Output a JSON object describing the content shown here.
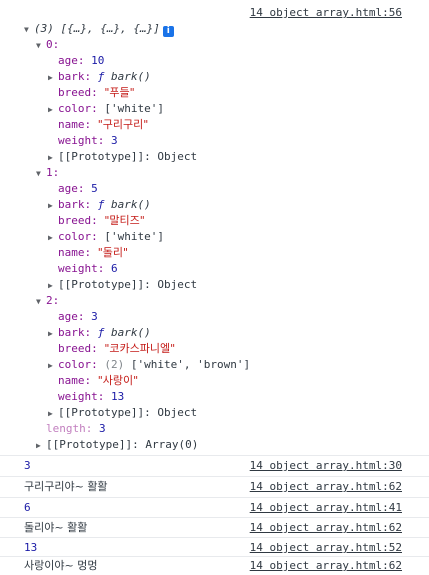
{
  "top_source": "14 object array.html:56",
  "array_summary": {
    "count": "(3)",
    "preview": "[{…}, {…}, {…}]",
    "badge": "i"
  },
  "items": [
    {
      "index": "0:",
      "age": "10",
      "bark_kw": "ƒ",
      "bark_name": "bark()",
      "breed": "\"푸들\"",
      "color": "['white']",
      "name": "\"구리구리\"",
      "weight": "3",
      "prototype": "Object"
    },
    {
      "index": "1:",
      "age": "5",
      "bark_kw": "ƒ",
      "bark_name": "bark()",
      "breed": "\"말티즈\"",
      "color": "['white']",
      "name": "\"돌리\"",
      "weight": "6",
      "prototype": "Object"
    },
    {
      "index": "2:",
      "age": "3",
      "bark_kw": "ƒ",
      "bark_name": "bark()",
      "breed": "\"코카스파니엘\"",
      "color_count": "(2)",
      "color": "['white', 'brown']",
      "name": "\"사랑이\"",
      "weight": "13",
      "prototype": "Object"
    }
  ],
  "labels": {
    "age": "age: ",
    "bark": "bark: ",
    "breed": "breed: ",
    "color": "color: ",
    "name": "name: ",
    "weight": "weight: ",
    "prototype": "[[Prototype]]: ",
    "length": "length: "
  },
  "length_value": "3",
  "array_prototype": "Array(0)",
  "logs": [
    {
      "text": "3",
      "kind": "number",
      "source": "14 object array.html:30"
    },
    {
      "text": "구리구리야~ 활활",
      "kind": "text",
      "source": "14 object array.html:62"
    },
    {
      "text": "6",
      "kind": "number",
      "source": "14 object array.html:41"
    },
    {
      "text": "돌리야~ 활활",
      "kind": "text",
      "source": "14 object array.html:62"
    },
    {
      "text": "13",
      "kind": "number",
      "source": "14 object array.html:52"
    },
    {
      "text": "사랑이야~ 멍멍",
      "kind": "text",
      "source": "14 object array.html:62"
    }
  ]
}
